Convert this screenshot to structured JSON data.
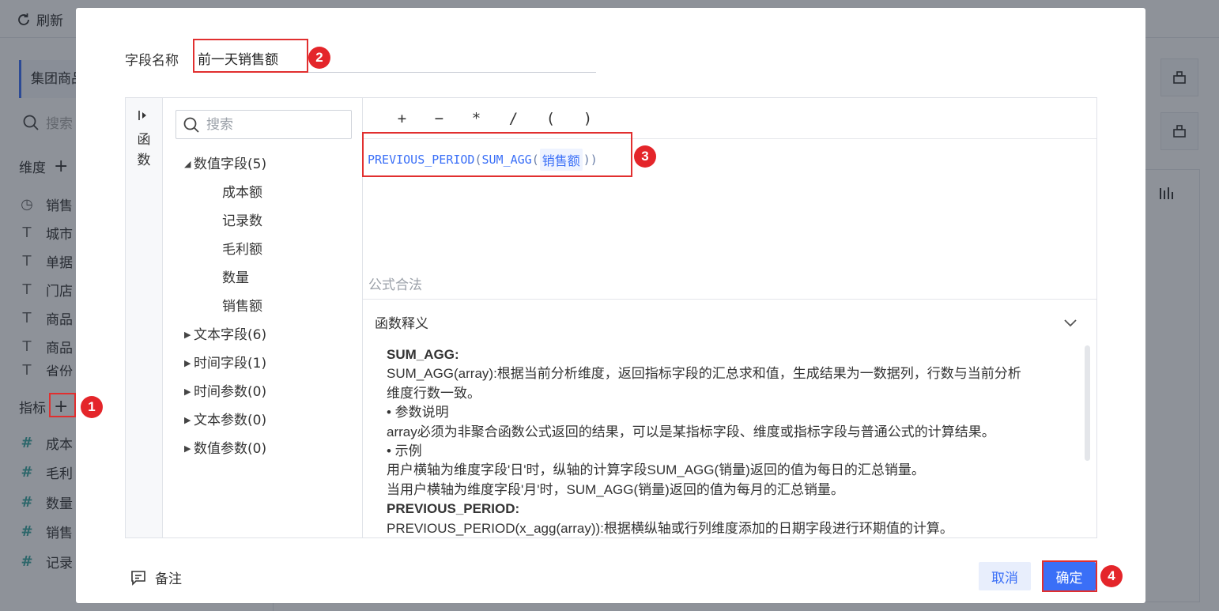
{
  "background": {
    "refresh_label": "刷新",
    "dataset_label": "集团商品",
    "search_placeholder": "搜索",
    "dimension_label": "维度",
    "dimension_items": [
      "销售",
      "城市",
      "单据",
      "门店",
      "商品",
      "商品",
      "省份"
    ],
    "measure_label": "指标",
    "measure_items": [
      "成本",
      "毛利",
      "数量",
      "销售",
      "记录"
    ]
  },
  "dialog": {
    "field_name_label": "字段名称",
    "field_name_value": "前一天销售额",
    "side_tab_label": [
      "函",
      "数"
    ],
    "tree_search_placeholder": "搜索",
    "tree": [
      {
        "label": "数值字段(5)",
        "expanded": true,
        "children": [
          "成本额",
          "记录数",
          "毛利额",
          "数量",
          "销售额"
        ]
      },
      {
        "label": "文本字段(6)",
        "expanded": false
      },
      {
        "label": "时间字段(1)",
        "expanded": false
      },
      {
        "label": "时间参数(0)",
        "expanded": false
      },
      {
        "label": "文本参数(0)",
        "expanded": false
      },
      {
        "label": "数值参数(0)",
        "expanded": false
      }
    ],
    "operators": [
      "+",
      "−",
      "*",
      "/",
      "(",
      ")"
    ],
    "formula": {
      "fn_outer": "PREVIOUS_PERIOD",
      "fn_inner": "SUM_AGG",
      "field": "销售额"
    },
    "validation_text": "公式合法",
    "explain_title": "函数释义",
    "explain_lines": [
      {
        "text": "SUM_AGG:",
        "bold": true
      },
      {
        "text": "SUM_AGG(array):根据当前分析维度，返回指标字段的汇总求和值，生成结果为一数据列，行数与当前分析",
        "bold": false
      },
      {
        "text": "维度行数一致。",
        "bold": false
      },
      {
        "text": "• 参数说明",
        "bold": false
      },
      {
        "text": "array必须为非聚合函数公式返回的结果，可以是某指标字段、维度或指标字段与普通公式的计算结果。",
        "bold": false
      },
      {
        "text": "• 示例",
        "bold": false
      },
      {
        "text": "用户横轴为维度字段'日'时，纵轴的计算字段SUM_AGG(销量)返回的值为每日的汇总销量。",
        "bold": false
      },
      {
        "text": "当用户横轴为维度字段'月'时，SUM_AGG(销量)返回的值为每月的汇总销量。",
        "bold": false
      },
      {
        "text": "PREVIOUS_PERIOD:",
        "bold": true
      },
      {
        "text": "PREVIOUS_PERIOD(x_agg(array)):根据横纵轴或行列维度添加的日期字段进行环期值的计算。",
        "bold": false
      }
    ],
    "note_label": "备注",
    "cancel_label": "取消",
    "ok_label": "确定"
  },
  "annotations": [
    "1",
    "2",
    "3",
    "4"
  ],
  "colors": {
    "accent": "#3a6ff7",
    "annotation_red": "#e4252a"
  }
}
